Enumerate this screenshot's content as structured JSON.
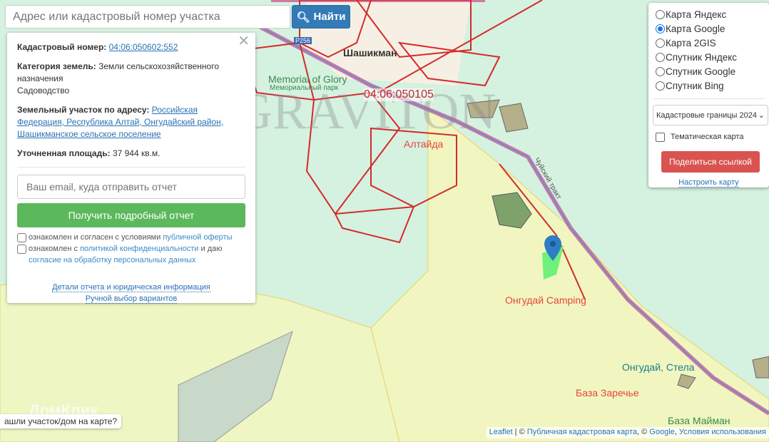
{
  "search": {
    "placeholder": "Адрес или кадастровый номер участка",
    "button": "Найти"
  },
  "map": {
    "labels": {
      "village": "Шашикман",
      "memorial": "Memorial of Glory",
      "memorial_sub": "Мемориальный парк",
      "quarter": "04:06:050105",
      "altaida": "Алтайда",
      "camping": "Онгудай Camping",
      "stela": "Онгудай, Стела",
      "zarechye": "База Заречье",
      "maiman": "База Майман",
      "road": "Чуйский тракт",
      "shield": "Р256"
    },
    "watermark": "GRAVITON",
    "domclick": "ДомКлик"
  },
  "info": {
    "cad_label": "Кадастровый номер:",
    "cad_value": "04:06:050602:552",
    "cat_label": "Категория земель:",
    "cat_value": "Земли сельскохозяйственного назначения",
    "use": "Садоводство",
    "addr_label": "Земельный участок по адресу:",
    "addr_value": "Российская Федерация, Республика Алтай, Онгудайский район, Шашикманское сельское поселение",
    "area_label": "Уточненная площадь:",
    "area_value": "37 944 кв.м.",
    "email_placeholder": "Ваш email, куда отправить отчет",
    "report_button": "Получить подробный отчет",
    "agree1_text": "ознакомлен и согласен с условиями",
    "agree1_link": "публичной оферты",
    "agree2_text": "ознакомлен с",
    "agree2_link": "политикой конфиденциальности",
    "agree2_mid": "и даю",
    "agree2_link2": "согласие на обработку персональных данных",
    "details_link": "Детали отчета и юридическая информация",
    "manual_link": "Ручной выбор вариантов"
  },
  "layers": {
    "options": [
      "Карта Яндекс",
      "Карта Google",
      "Карта 2GIS",
      "Спутник Яндекс",
      "Спутник Google",
      "Спутник Bing"
    ],
    "selected": 1,
    "overlay": "Кадастровые границы 2024",
    "thematic": "Тематическая карта",
    "share": "Поделиться ссылкой",
    "configure": "Настроить карту"
  },
  "attribution": {
    "leaflet": "Leaflet",
    "sep": " | © ",
    "pkk": "Публичная кадастровая карта",
    "sep2": ", © ",
    "google": "Google",
    "sep3": ", ",
    "terms": "Условия использования"
  },
  "found_prompt": "ашли участок/дом на карте?"
}
